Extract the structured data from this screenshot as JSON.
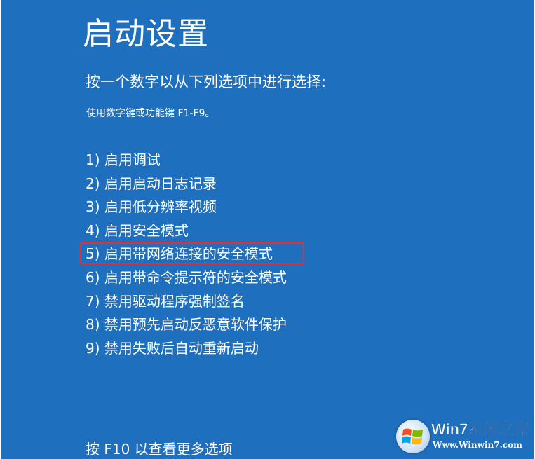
{
  "screen": {
    "title": "启动设置",
    "instruction": "按一个数字以从下列选项中进行选择:",
    "hint": "使用数字键或功能键 F1-F9。",
    "options": [
      {
        "label": "1) 启用调试"
      },
      {
        "label": "2) 启用启动日志记录"
      },
      {
        "label": "3) 启用低分辨率视频"
      },
      {
        "label": "4) 启用安全模式"
      },
      {
        "label": "5) 启用带网络连接的安全模式"
      },
      {
        "label": "6) 启用带命令提示符的安全模式"
      },
      {
        "label": "7) 禁用驱动程序强制签名"
      },
      {
        "label": "8) 禁用预先启动反恶意软件保护"
      },
      {
        "label": "9) 禁用失败后自动重新启动"
      }
    ],
    "highlighted_option_index": 4,
    "more_options": "按 F10 以查看更多选项"
  },
  "watermark": {
    "brand": "Win7系统之家",
    "url": "Www.Winwin7.com"
  },
  "colors": {
    "background": "#1f6fbf",
    "text": "#ffffff",
    "highlight_border": "#e0303a"
  }
}
